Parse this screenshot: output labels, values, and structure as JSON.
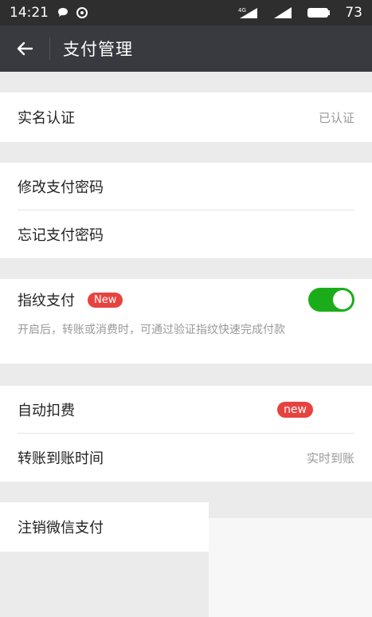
{
  "status_bar": {
    "time": "14:21",
    "network": "4G",
    "battery": "73"
  },
  "header": {
    "title": "支付管理"
  },
  "rows": {
    "real_name": {
      "label": "实名认证",
      "value": "已认证"
    },
    "change_password": {
      "label": "修改支付密码"
    },
    "forgot_password": {
      "label": "忘记支付密码"
    },
    "fingerprint": {
      "label": "指纹支付",
      "badge": "New",
      "enabled": true,
      "description": "开启后，转账或消费时，可通过验证指纹快速完成付款"
    },
    "auto_deduct": {
      "label": "自动扣费",
      "badge": "new"
    },
    "transfer_time": {
      "label": "转账到账时间",
      "value": "实时到账"
    },
    "cancel_wechat_pay": {
      "label": "注销微信支付"
    }
  },
  "colors": {
    "accent_green": "#1aad19",
    "badge_red": "#e64340",
    "header_bg": "#393a3f"
  }
}
